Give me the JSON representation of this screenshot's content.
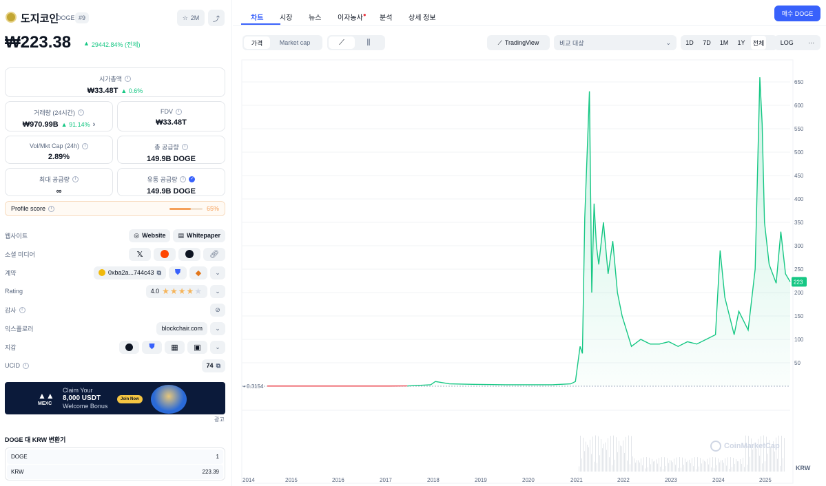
{
  "coin": {
    "name": "도지코인",
    "symbol": "DOGE",
    "rank": "#9",
    "watch_count": "2M",
    "price": "₩223.38",
    "change": "29442.84% (전체)"
  },
  "stats": {
    "market_cap": {
      "label": "시가총액",
      "value": "₩33.48T",
      "change": "0.6%"
    },
    "volume": {
      "label": "거래량 (24시간)",
      "value": "₩970.99B",
      "change": "91.14%"
    },
    "fdv": {
      "label": "FDV",
      "value": "₩33.48T"
    },
    "vol_mkt": {
      "label": "Vol/Mkt Cap (24h)",
      "value": "2.89%"
    },
    "total_supply": {
      "label": "총 공급량",
      "value": "149.9B DOGE"
    },
    "max_supply": {
      "label": "최대 공급량",
      "value": "∞"
    },
    "circ_supply": {
      "label": "유통 공급량",
      "value": "149.9B DOGE"
    },
    "profile": {
      "label": "Profile score",
      "value": "65%",
      "fill": 0.65
    }
  },
  "links": {
    "website_label": "웹사이트",
    "website": "Website",
    "whitepaper": "Whitepaper",
    "social_label": "소셜 미디어",
    "contract_label": "계약",
    "contract": "0xba2a...744c43",
    "rating_label": "Rating",
    "rating": "4.0",
    "rating_stars": 4,
    "audit_label": "감사",
    "explorer_label": "익스플로러",
    "explorer": "blockchair.com",
    "wallet_label": "지갑",
    "ucid_label": "UCID",
    "ucid": "74"
  },
  "ad": {
    "brand": "MEXC",
    "line1": "Claim Your",
    "line2": "8,000 USDT",
    "line3": "Welcome Bonus",
    "cta": "Join Now",
    "tag": "광고"
  },
  "converter": {
    "title": "DOGE 대 KRW 변환기",
    "from": "DOGE",
    "from_val": "1",
    "to": "KRW",
    "to_val": "223.39"
  },
  "tabs": [
    "차트",
    "시장",
    "뉴스",
    "이자농사",
    "분석",
    "상세 정보"
  ],
  "buy_label": "매수 DOGE",
  "toolbar": {
    "price": "가격",
    "mcap": "Market cap",
    "tradingview": "TradingView",
    "compare": "비교 대상",
    "timeframes": [
      "1D",
      "7D",
      "1M",
      "1Y",
      "전체"
    ],
    "log": "LOG",
    "more": "···"
  },
  "chart_data": {
    "type": "line",
    "title": "",
    "y_ticks": [
      650,
      600,
      550,
      500,
      450,
      400,
      350,
      300,
      250,
      200,
      150,
      100,
      50.0
    ],
    "x_ticks": [
      "2014",
      "2015",
      "2016",
      "2017",
      "2018",
      "2019",
      "2020",
      "2021",
      "2022",
      "2023",
      "2024",
      "2025"
    ],
    "ylim": [
      -50,
      700
    ],
    "baseline_label": "0.3154",
    "current_label": "223",
    "y_unit": "KRW",
    "watermark": "CoinMarketCap",
    "series": [
      {
        "x": [
          2014.4,
          2015,
          2016,
          2017,
          2017.4,
          2017.9,
          2018.0,
          2018.3,
          2018.8,
          2019.5,
          2020,
          2020.5,
          2020.9,
          2021.0,
          2021.1,
          2021.15,
          2021.2,
          2021.3,
          2021.35,
          2021.4,
          2021.45,
          2021.5,
          2021.6,
          2021.7,
          2021.8,
          2021.9,
          2022.0,
          2022.2,
          2022.4,
          2022.6,
          2022.8,
          2023.0,
          2023.2,
          2023.4,
          2023.6,
          2023.8,
          2024.0,
          2024.1,
          2024.2,
          2024.3,
          2024.4,
          2024.5,
          2024.7,
          2024.85,
          2024.95,
          2025.0,
          2025.05,
          2025.15,
          2025.3,
          2025.4,
          2025.5,
          2025.6
        ],
        "y": [
          0.3,
          0.3,
          0.3,
          0.3,
          0.5,
          3,
          10,
          5,
          4,
          3,
          3,
          3,
          5,
          10,
          85,
          70,
          360,
          630,
          200,
          390,
          300,
          260,
          350,
          240,
          310,
          200,
          150,
          85,
          100,
          90,
          90,
          95,
          85,
          95,
          90,
          100,
          110,
          290,
          190,
          150,
          110,
          160,
          120,
          250,
          660,
          560,
          350,
          260,
          220,
          330,
          240,
          223
        ]
      }
    ]
  }
}
